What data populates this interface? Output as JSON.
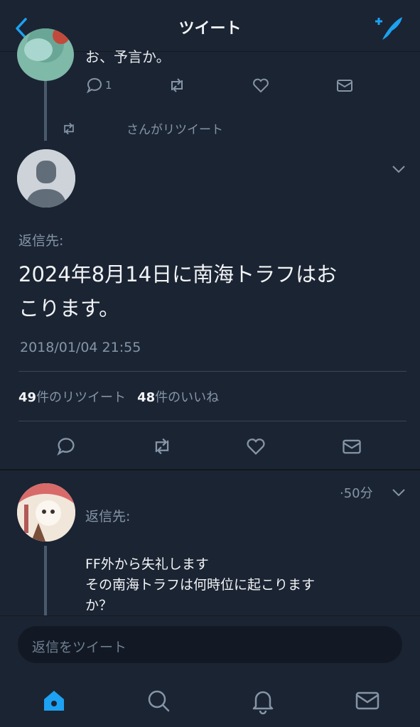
{
  "header": {
    "title": "ツイート"
  },
  "previous_tweet": {
    "text": "お、予言か。",
    "reply_count": "1"
  },
  "retweet_context": {
    "text": "さんがリツイート"
  },
  "main_tweet": {
    "reply_to_label": "返信先:",
    "body_line1": "2024年8月14日に南海トラフはお",
    "body_line2": "こります。",
    "timestamp": "2018/01/04 21:55",
    "retweets_count": "49",
    "retweets_label": "件のリツイート",
    "likes_count": "48",
    "likes_label": "件のいいね"
  },
  "reply_tweet": {
    "time": "·50分",
    "reply_to_label": "返信先:",
    "line1": "FF外から失礼します",
    "line2": "その南海トラフは何時位に起こります",
    "line3": "か？"
  },
  "composer": {
    "placeholder": "返信をツイート"
  },
  "tabs": [
    {
      "name": "home-icon",
      "active": true
    },
    {
      "name": "search-icon"
    },
    {
      "name": "notifications-icon"
    },
    {
      "name": "messages-icon"
    }
  ],
  "colors": {
    "accent": "#1da1f2",
    "background": "#1b2433",
    "muted": "#8595a6"
  }
}
